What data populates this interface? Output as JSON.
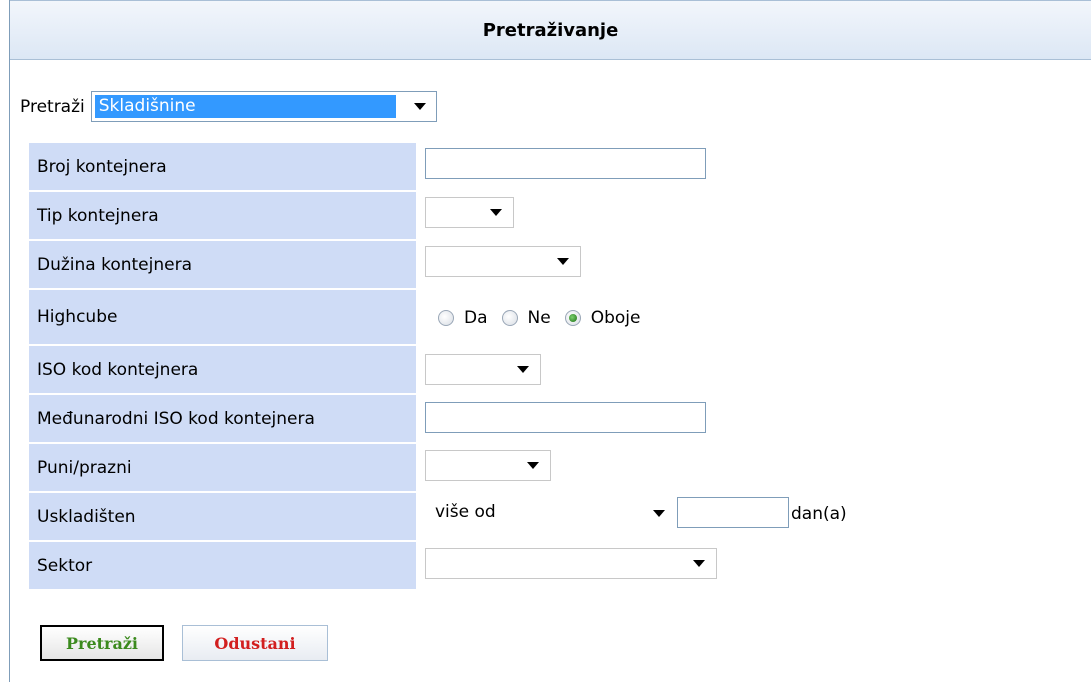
{
  "header": {
    "title": "Pretraživanje"
  },
  "search": {
    "label": "Pretraži",
    "selected": "Skladišnine"
  },
  "form": {
    "container_number": {
      "label": "Broj kontejnera",
      "value": ""
    },
    "container_type": {
      "label": "Tip kontejnera",
      "value": ""
    },
    "container_length": {
      "label": "Dužina kontejnera",
      "value": ""
    },
    "highcube": {
      "label": "Highcube",
      "options": [
        "Da",
        "Ne",
        "Oboje"
      ],
      "selected": "Oboje"
    },
    "iso_code": {
      "label": "ISO kod kontejnera",
      "value": ""
    },
    "intl_iso_code": {
      "label": "Međunarodni ISO kod kontejnera",
      "value": ""
    },
    "full_empty": {
      "label": "Puni/prazni",
      "value": ""
    },
    "stored": {
      "label": "Uskladišten",
      "operator": "više od",
      "days": "",
      "unit": "dan(a)"
    },
    "sector": {
      "label": "Sektor",
      "value": ""
    }
  },
  "buttons": {
    "search": "Pretraži",
    "cancel": "Odustani"
  }
}
